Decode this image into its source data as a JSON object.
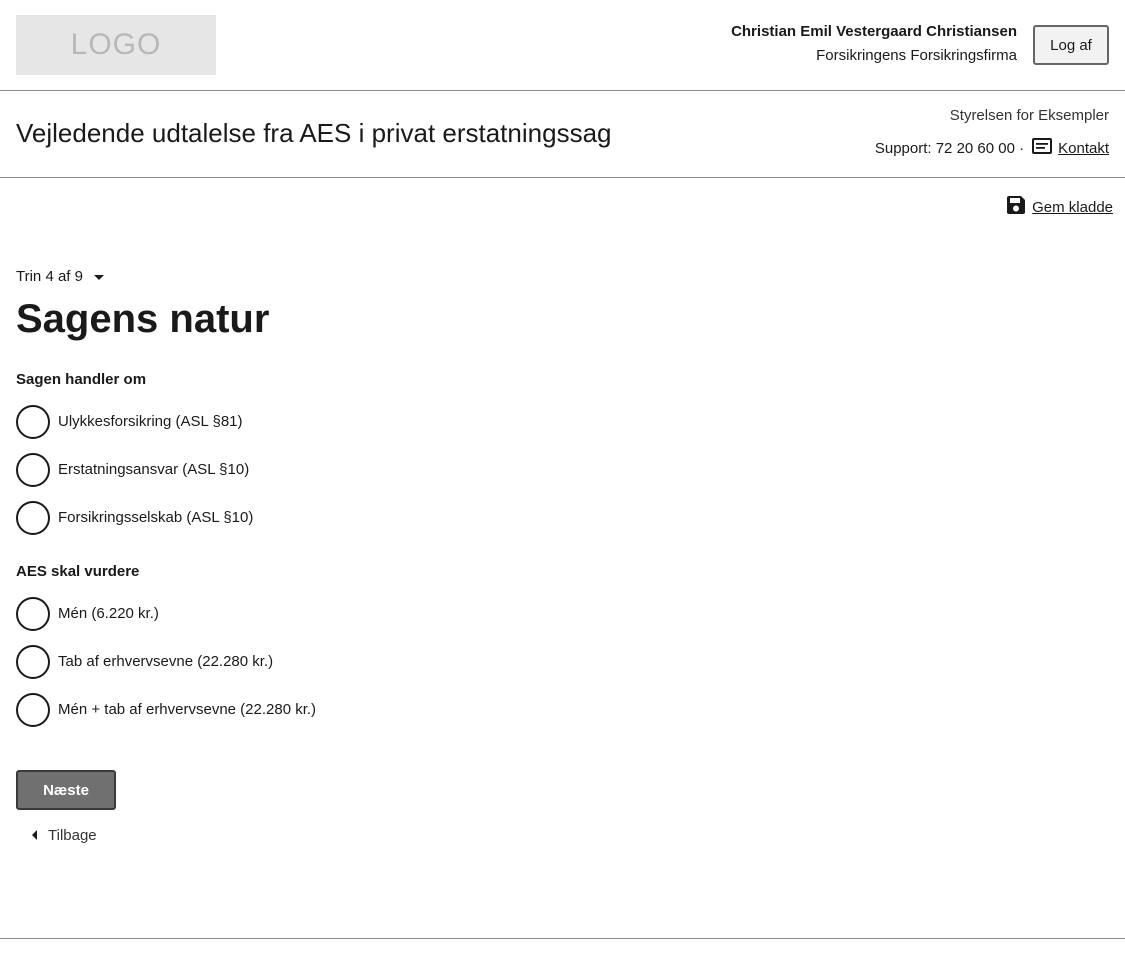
{
  "header": {
    "logo_text": "LOGO",
    "user_name": "Christian Emil Vestergaard Christiansen",
    "user_org": "Forsikringens Forsikringsfirma",
    "logout_label": "Log af"
  },
  "titlebar": {
    "title": "Vejledende udtalelse fra AES i privat erstatningssag",
    "agency": "Styrelsen for Eksempler",
    "support_text": "Support: 72 20 60 00 ·",
    "contact_label": "Kontakt",
    "contact_icon": "message-icon"
  },
  "toolbar": {
    "save_draft_label": "Gem kladde",
    "save_icon": "floppy-disk-icon"
  },
  "form": {
    "step_label": "Trin 4 af 9",
    "section_title": "Sagens natur",
    "group1": {
      "label": "Sagen handler om",
      "options": [
        {
          "label": "Ulykkesforsikring (ASL §81)",
          "selected": false
        },
        {
          "label": "Erstatningsansvar (ASL §10)",
          "selected": false
        },
        {
          "label": "Forsikringsselskab (ASL §10)",
          "selected": false
        }
      ]
    },
    "group2": {
      "label": "AES skal vurdere",
      "options": [
        {
          "label": "Mén (6.220 kr.)",
          "selected": false
        },
        {
          "label": "Tab af erhvervsevne (22.280 kr.)",
          "selected": false
        },
        {
          "label": "Mén + tab af erhvervsevne (22.280 kr.)",
          "selected": false
        }
      ]
    },
    "next_label": "Næste",
    "back_label": "Tilbage"
  }
}
